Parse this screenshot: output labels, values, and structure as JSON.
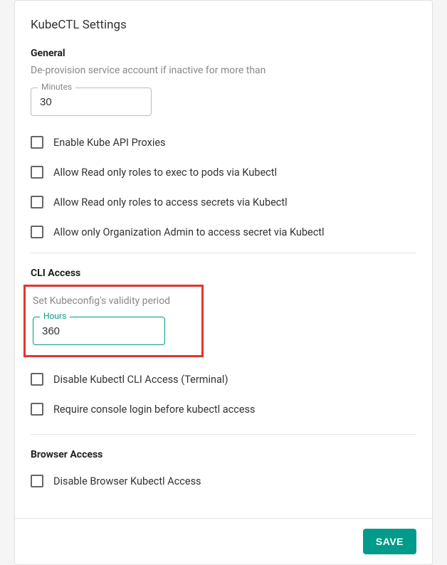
{
  "title": "KubeCTL Settings",
  "sections": {
    "general": {
      "label": "General",
      "sub": "De-provision service account if inactive for more than",
      "field_label": "Minutes",
      "field_value": "30",
      "checks": [
        "Enable Kube API Proxies",
        "Allow Read only roles to exec to pods via Kubectl",
        "Allow Read only roles to access secrets via Kubectl",
        "Allow only Organization Admin to access secret via Kubectl"
      ]
    },
    "cli": {
      "label": "CLI Access",
      "sub": "Set Kubeconfig's validity period",
      "field_label": "Hours",
      "field_value": "360",
      "checks": [
        "Disable Kubectl CLI Access (Terminal)",
        "Require console login before kubectl access"
      ]
    },
    "browser": {
      "label": "Browser Access",
      "checks": [
        "Disable Browser Kubectl Access"
      ]
    }
  },
  "footer": {
    "save": "SAVE"
  }
}
